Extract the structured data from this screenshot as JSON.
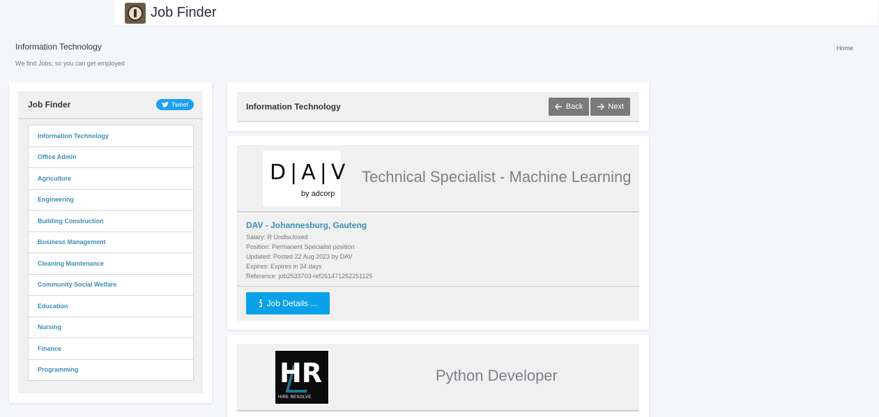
{
  "header": {
    "brand": "Job Finder",
    "logo_icon": "job-finder-logo"
  },
  "page": {
    "title": "Information Technology",
    "subtitle": "We find Jobs, so you can get employed",
    "breadcrumb": "Home"
  },
  "sidebar": {
    "title": "Job Finder",
    "tweet_label": "Tweet",
    "categories": [
      "Information Technology",
      "Office Admin",
      "Agriculture",
      "Engineering",
      "Building Construction",
      "Business Management",
      "Cleaning Maintenance",
      "Community Social Welfare",
      "Education",
      "Nursing",
      "Finance",
      "Programming"
    ]
  },
  "listing_header": {
    "title": "Information Technology",
    "back_label": "Back",
    "next_label": "Next"
  },
  "jobs": [
    {
      "logo_text": "D|A|V",
      "logo_sub": "by adcorp",
      "title": "Technical Specialist - Machine Learning",
      "company": "DAV - Johannesburg, Gauteng",
      "salary": "Salary: R Undisclosed",
      "position": "Position: Permanent Specialist position",
      "updated": "Updated: Posted 22 Aug 2023 by DAV",
      "expires": "Expires: Expires in 34 days",
      "reference": "Reference: job2533703-ref261471252251125",
      "details_label": "Job Details ..."
    },
    {
      "logo_text": "HR",
      "logo_sub": "HIRE RESOLVE",
      "title": "Python Developer"
    }
  ],
  "colors": {
    "accent": "#3a8fb7",
    "button_blue": "#0aa1e8",
    "tweet_blue": "#1da1f2",
    "nav_gray": "#7a7a7a"
  }
}
